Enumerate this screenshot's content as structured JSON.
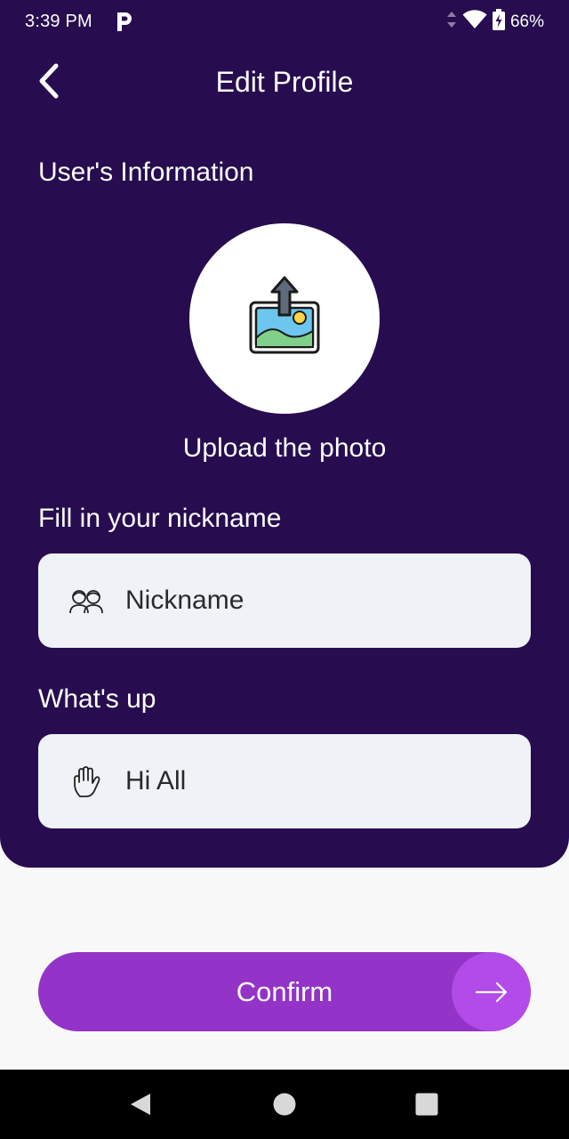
{
  "status_bar": {
    "time": "3:39 PM",
    "app_icon": "parking-p-icon",
    "battery": "66%",
    "icons": [
      "data-arrows-icon",
      "wifi-icon",
      "battery-charging-icon"
    ]
  },
  "header": {
    "title": "Edit Profile",
    "back_icon": "chevron-left-icon"
  },
  "user_info": {
    "section_label": "User's Information",
    "upload_icon": "image-upload-icon",
    "upload_label": "Upload the photo"
  },
  "nickname": {
    "label": "Fill in your nickname",
    "icon": "people-icon",
    "placeholder": "Nickname"
  },
  "whats_up": {
    "label": "What's up",
    "icon": "waving-hand-icon",
    "value": "Hi All"
  },
  "confirm": {
    "label": "Confirm",
    "icon": "arrow-right-icon"
  },
  "nav_bar": {
    "buttons": [
      "back-triangle-icon",
      "home-circle-icon",
      "recents-square-icon"
    ]
  },
  "colors": {
    "panel": "#270d4f",
    "field_bg": "#eff2f7",
    "confirm": "#9333c8",
    "confirm_arrow_bg": "#b24be8"
  }
}
